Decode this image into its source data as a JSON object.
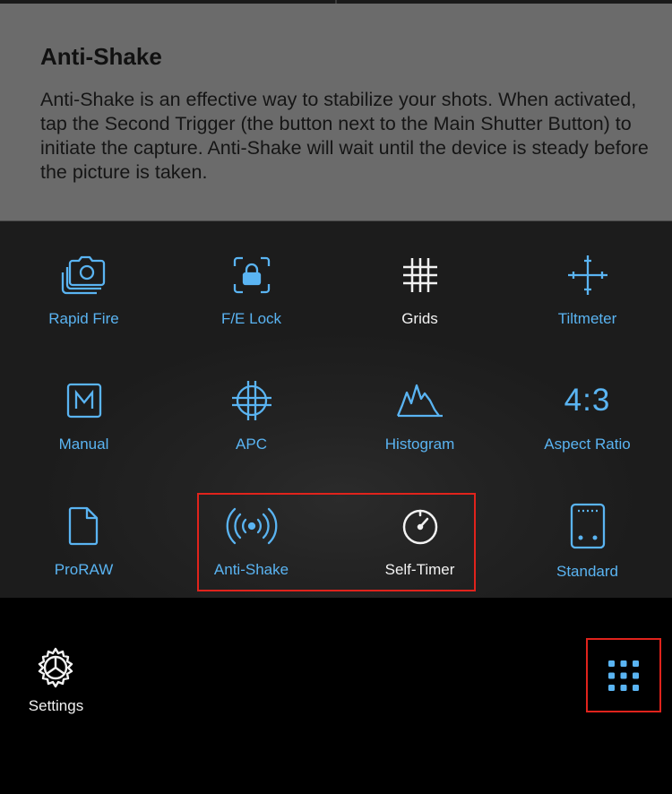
{
  "info": {
    "title": "Anti-Shake",
    "description": "Anti-Shake is an effective way to stabilize your shots. When activated, tap the Second Trigger (the button next to the Main Shutter Button) to initiate the capture. Anti-Shake will wait until the device is steady before the picture is taken."
  },
  "tools": [
    {
      "label": "Rapid Fire",
      "icon": "rapid-fire-icon"
    },
    {
      "label": "F/E Lock",
      "icon": "lock-icon"
    },
    {
      "label": "Grids",
      "icon": "grid-icon"
    },
    {
      "label": "Tiltmeter",
      "icon": "crosshair-icon"
    },
    {
      "label": "Manual",
      "icon": "manual-m-icon"
    },
    {
      "label": "APC",
      "icon": "apc-icon"
    },
    {
      "label": "Histogram",
      "icon": "histogram-icon"
    },
    {
      "label": "Aspect Ratio",
      "icon": "aspect-ratio-icon",
      "icon_text": "4:3"
    },
    {
      "label": "ProRAW",
      "icon": "document-icon"
    },
    {
      "label": "Anti-Shake",
      "icon": "vibration-icon"
    },
    {
      "label": "Self-Timer",
      "icon": "timer-icon"
    },
    {
      "label": "Standard",
      "icon": "standard-mode-icon"
    }
  ],
  "footer": {
    "settings_label": "Settings"
  },
  "colors": {
    "accent": "#5ab4f2",
    "highlight_border": "#e0231c",
    "info_background": "#6b6b6b",
    "grid_background": "#1c1c1c"
  }
}
